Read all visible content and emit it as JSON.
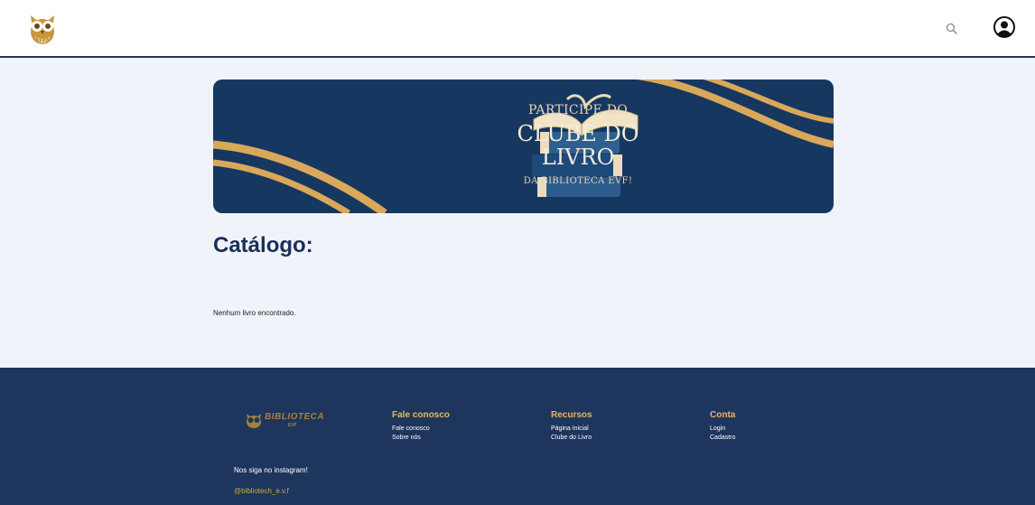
{
  "header": {
    "logo_icon": "owl-logo-icon",
    "search_icon": "search-icon",
    "account_icon": "account-icon"
  },
  "banner": {
    "line1": "PARTICIPE DO",
    "line2": "CLUBE DO",
    "line3": "LIVRO",
    "line4": "DA BIBLIOTECA EVF!",
    "image_icon": "books-stack-icon"
  },
  "catalog": {
    "title": "Catálogo:",
    "empty_message": "Nenhum livro encontrado."
  },
  "footer": {
    "logo_name": "BIBLIOTECA",
    "logo_sub": "EVF",
    "follow_text": "Nos siga no instagram!",
    "instagram_handle": "@bibliotech_e.v.f",
    "columns": [
      {
        "title": "Fale conosco",
        "links": [
          "Fale conosco",
          "Sobre nós"
        ]
      },
      {
        "title": "Recursos",
        "links": [
          "Página Inicial",
          "Clube do Livro"
        ]
      },
      {
        "title": "Conta",
        "links": [
          "Login",
          "Cadastro"
        ]
      }
    ]
  },
  "colors": {
    "primary_navy": "#1e355d",
    "banner_navy": "#163760",
    "accent_gold": "#e9b856",
    "title_navy": "#1a2f5a",
    "page_bg": "#f0f3f9"
  }
}
